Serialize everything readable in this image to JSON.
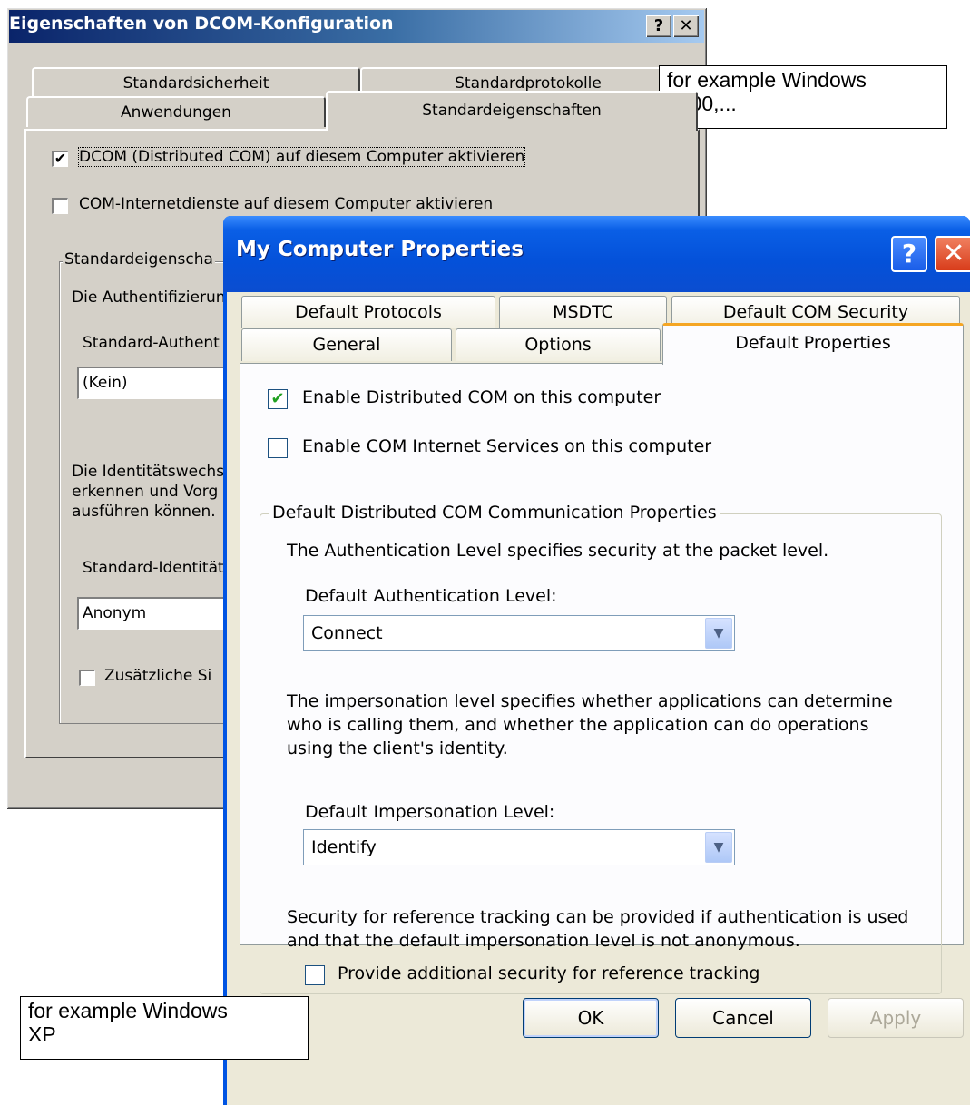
{
  "w2k": {
    "title": "Eigenschaften von DCOM-Konfiguration",
    "help_glyph": "?",
    "close_glyph": "✕",
    "tabs": [
      "Standardsicherheit",
      "Standardprotokolle",
      "Anwendungen",
      "Standardeigenschaften"
    ],
    "enable_dcom": {
      "label": "DCOM (Distributed COM) auf diesem Computer aktivieren",
      "checked": true
    },
    "enable_cis": {
      "label": "COM-Internetdienste auf diesem Computer aktivieren",
      "checked": false
    },
    "group_label": "Standardeigenscha",
    "auth_desc": "Die Authentifizierun",
    "auth_label": "Standard-Authent",
    "auth_value": "(Kein)",
    "imp_desc": [
      "Die Identitätswechs",
      "erkennen und Vorg",
      "ausführen können."
    ],
    "imp_label": "Standard-Identität",
    "imp_value": "Anonym",
    "extra_security": {
      "label": "Zusätzliche Si",
      "checked": false
    }
  },
  "xp": {
    "title": "My Computer Properties",
    "help_glyph": "?",
    "close_glyph": "✕",
    "tabs": [
      "Default Protocols",
      "MSDTC",
      "Default COM Security",
      "General",
      "Options",
      "Default Properties"
    ],
    "enable_dcom": {
      "label": "Enable Distributed COM on this computer",
      "checked": true
    },
    "enable_cis": {
      "label": "Enable COM Internet Services on this computer",
      "checked": false
    },
    "group_label": "Default Distributed COM Communication Properties",
    "auth_desc": "The Authentication Level specifies security at the packet level.",
    "auth_label": "Default Authentication Level:",
    "auth_value": "Connect",
    "imp_desc": [
      "The impersonation level specifies whether applications can determine",
      "who is calling them, and whether the application can do operations",
      "using the client's identity."
    ],
    "imp_label": "Default Impersonation Level:",
    "imp_value": "Identify",
    "ref_desc": [
      "Security for reference tracking can be provided if authentication is used",
      "and that the default impersonation level is not anonymous."
    ],
    "ref_tracking": {
      "label": "Provide additional security for reference tracking",
      "checked": false
    },
    "buttons": {
      "ok": "OK",
      "cancel": "Cancel",
      "apply": "Apply"
    },
    "dropdown_glyph": "▼"
  },
  "notes": {
    "w2k": [
      "for example Windows",
      "2000,..."
    ],
    "xp": [
      "for example Windows",
      "XP"
    ]
  },
  "check_glyph": "✔"
}
